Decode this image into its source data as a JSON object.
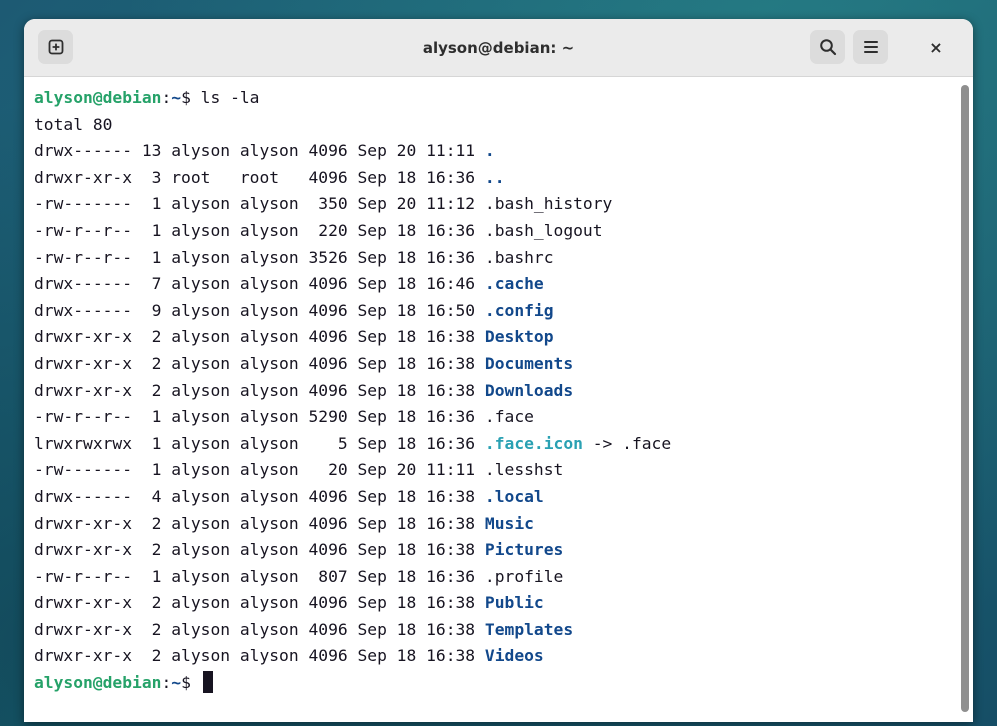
{
  "window": {
    "title": "alyson@debian: ~"
  },
  "toolbar": {
    "new_tab_icon": "new-tab-icon",
    "search_icon": "search-icon",
    "menu_icon": "hamburger-menu-icon",
    "close_label": "×"
  },
  "colors": {
    "prompt_user": "#26a269",
    "directory": "#12488b",
    "symlink": "#2aa1b3",
    "text": "#171421"
  },
  "prompt": {
    "user_host": "alyson@debian",
    "separator": ":",
    "path": "~",
    "symbol": "$ "
  },
  "command": "ls -la",
  "total_line": "total 80",
  "listing": [
    {
      "info": "drwx------ 13 alyson alyson 4096 Sep 20 11:11 ",
      "name": ".",
      "type": "dir",
      "target": ""
    },
    {
      "info": "drwxr-xr-x  3 root   root   4096 Sep 18 16:36 ",
      "name": "..",
      "type": "dir",
      "target": ""
    },
    {
      "info": "-rw-------  1 alyson alyson  350 Sep 20 11:12 ",
      "name": ".bash_history",
      "type": "file",
      "target": ""
    },
    {
      "info": "-rw-r--r--  1 alyson alyson  220 Sep 18 16:36 ",
      "name": ".bash_logout",
      "type": "file",
      "target": ""
    },
    {
      "info": "-rw-r--r--  1 alyson alyson 3526 Sep 18 16:36 ",
      "name": ".bashrc",
      "type": "file",
      "target": ""
    },
    {
      "info": "drwx------  7 alyson alyson 4096 Sep 18 16:46 ",
      "name": ".cache",
      "type": "dir",
      "target": ""
    },
    {
      "info": "drwx------  9 alyson alyson 4096 Sep 18 16:50 ",
      "name": ".config",
      "type": "dir",
      "target": ""
    },
    {
      "info": "drwxr-xr-x  2 alyson alyson 4096 Sep 18 16:38 ",
      "name": "Desktop",
      "type": "dir",
      "target": ""
    },
    {
      "info": "drwxr-xr-x  2 alyson alyson 4096 Sep 18 16:38 ",
      "name": "Documents",
      "type": "dir",
      "target": ""
    },
    {
      "info": "drwxr-xr-x  2 alyson alyson 4096 Sep 18 16:38 ",
      "name": "Downloads",
      "type": "dir",
      "target": ""
    },
    {
      "info": "-rw-r--r--  1 alyson alyson 5290 Sep 18 16:36 ",
      "name": ".face",
      "type": "file",
      "target": ""
    },
    {
      "info": "lrwxrwxrwx  1 alyson alyson    5 Sep 18 16:36 ",
      "name": ".face.icon",
      "type": "link",
      "target": " -> .face"
    },
    {
      "info": "-rw-------  1 alyson alyson   20 Sep 20 11:11 ",
      "name": ".lesshst",
      "type": "file",
      "target": ""
    },
    {
      "info": "drwx------  4 alyson alyson 4096 Sep 18 16:38 ",
      "name": ".local",
      "type": "dir",
      "target": ""
    },
    {
      "info": "drwxr-xr-x  2 alyson alyson 4096 Sep 18 16:38 ",
      "name": "Music",
      "type": "dir",
      "target": ""
    },
    {
      "info": "drwxr-xr-x  2 alyson alyson 4096 Sep 18 16:38 ",
      "name": "Pictures",
      "type": "dir",
      "target": ""
    },
    {
      "info": "-rw-r--r--  1 alyson alyson  807 Sep 18 16:36 ",
      "name": ".profile",
      "type": "file",
      "target": ""
    },
    {
      "info": "drwxr-xr-x  2 alyson alyson 4096 Sep 18 16:38 ",
      "name": "Public",
      "type": "dir",
      "target": ""
    },
    {
      "info": "drwxr-xr-x  2 alyson alyson 4096 Sep 18 16:38 ",
      "name": "Templates",
      "type": "dir",
      "target": ""
    },
    {
      "info": "drwxr-xr-x  2 alyson alyson 4096 Sep 18 16:38 ",
      "name": "Videos",
      "type": "dir",
      "target": ""
    }
  ]
}
